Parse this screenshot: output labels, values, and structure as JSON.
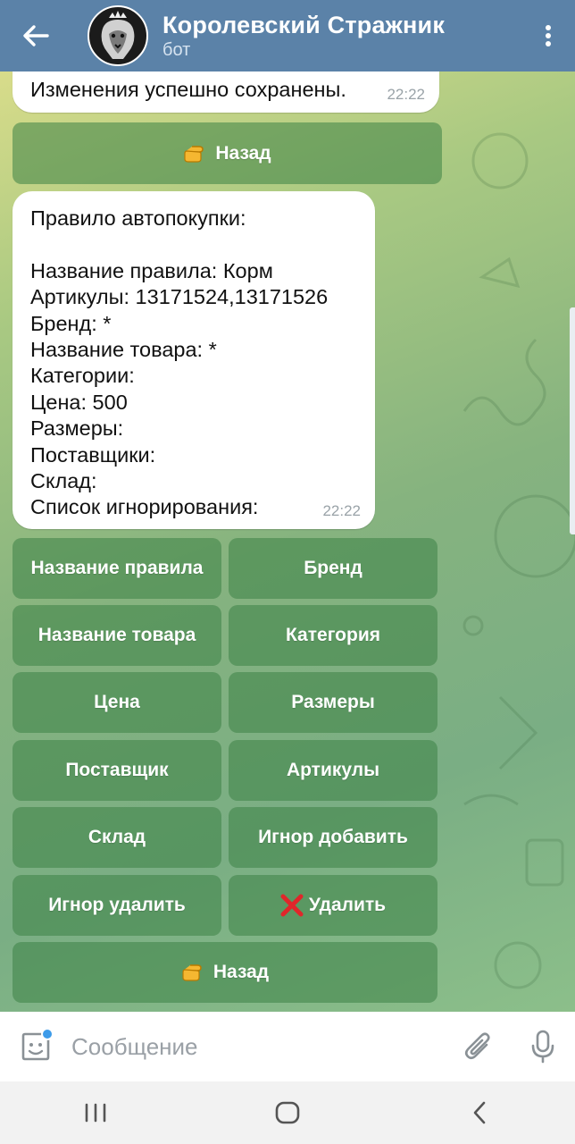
{
  "header": {
    "title": "Королевский Стражник",
    "subtitle": "бот",
    "back_icon": "arrow-left-icon",
    "menu_icon": "more-vertical-icon",
    "avatar_icon": "lion-crown-icon",
    "bg_color": "#5b82a8"
  },
  "messages": [
    {
      "text": "Изменения успешно сохранены.",
      "time": "22:22"
    },
    {
      "lines": [
        "Правило автопокупки:",
        "",
        "Название правила: Корм",
        "Артикулы: 13171524,13171526",
        "Бренд: *",
        "Название товара: *",
        "Категории:",
        "Цена: 500",
        "Размеры:",
        "Поставщики:",
        "Склад:",
        "Список игнорирования:"
      ],
      "time": "22:22"
    }
  ],
  "keyboard_top": {
    "back_label": "Назад",
    "back_icon": "pointing-hand-icon"
  },
  "keyboard": {
    "rule_name": "Название правила",
    "brand": "Бренд",
    "product_name": "Название товара",
    "category": "Категория",
    "price": "Цена",
    "sizes": "Размеры",
    "supplier": "Поставщик",
    "articles": "Артикулы",
    "warehouse": "Склад",
    "ignore_add": "Игнор добавить",
    "ignore_remove": "Игнор удалить",
    "delete": "Удалить",
    "delete_icon": "red-cross-icon",
    "back": "Назад",
    "back_icon": "pointing-hand-icon"
  },
  "input": {
    "placeholder": "Сообщение",
    "emoji_icon": "sticker-emoji-icon",
    "attach_icon": "paperclip-icon",
    "mic_icon": "microphone-icon"
  },
  "navbar": {
    "recent_icon": "recent-apps-icon",
    "home_icon": "home-icon",
    "back_icon": "nav-back-icon"
  }
}
